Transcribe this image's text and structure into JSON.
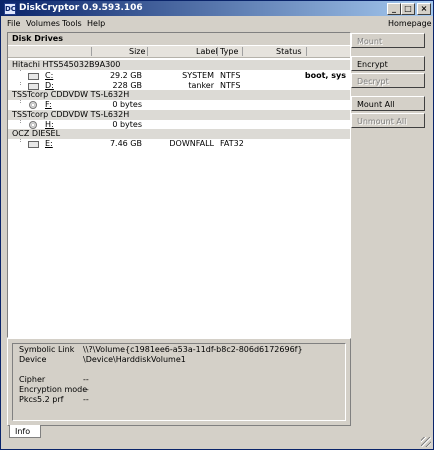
{
  "title": "DiskCryptor 0.9.593.106",
  "app_icon_label": "DC",
  "window_buttons": {
    "minimize": "_",
    "maximize": "□",
    "close": "×"
  },
  "menu": [
    "File",
    "Volumes",
    "Tools",
    "Help"
  ],
  "homepage": "Homepage",
  "drives_caption": "Disk Drives",
  "columns": {
    "size": "Size",
    "label": "Label",
    "type": "Type",
    "status": "Status"
  },
  "disks": [
    {
      "name": "Hitachi HTS545032B9A300",
      "volumes": [
        {
          "letter": "C:",
          "size": "29.2 GB",
          "label": "SYSTEM",
          "type": "NTFS",
          "status": "boot, sys"
        },
        {
          "letter": "D:",
          "size": "228 GB",
          "label": "tanker",
          "type": "NTFS",
          "status": ""
        }
      ]
    },
    {
      "name": "TSSTcorp CDDVDW TS-L632H",
      "volumes": [
        {
          "letter": "F:",
          "size": "0 bytes",
          "label": "",
          "type": "",
          "status": ""
        }
      ]
    },
    {
      "name": "TSSTcorp CDDVDW TS-L632H",
      "volumes": [
        {
          "letter": "H:",
          "size": "0 bytes",
          "label": "",
          "type": "",
          "status": ""
        }
      ]
    },
    {
      "name": "OCZ DIESEL",
      "volumes": [
        {
          "letter": "E:",
          "size": "7.46 GB",
          "label": "DOWNFALL",
          "type": "FAT32",
          "status": ""
        }
      ]
    }
  ],
  "buttons": {
    "mount": "Mount",
    "encrypt": "Encrypt",
    "decrypt": "Decrypt",
    "mount_all": "Mount All",
    "unmount_all": "Unmount All"
  },
  "info": {
    "symbolic_link_label": "Symbolic Link",
    "symbolic_link_value": "\\\\?\\Volume{c1981ee6-a53a-11df-b8c2-806d6172696f}",
    "device_label": "Device",
    "device_value": "\\Device\\HarddiskVolume1",
    "cipher_label": "Cipher",
    "cipher_value": "--",
    "encryption_mode_label": "Encryption mode",
    "encryption_mode_value": "--",
    "prf_label": "Pkcs5.2 prf",
    "prf_value": "--"
  },
  "tab_info": "Info"
}
